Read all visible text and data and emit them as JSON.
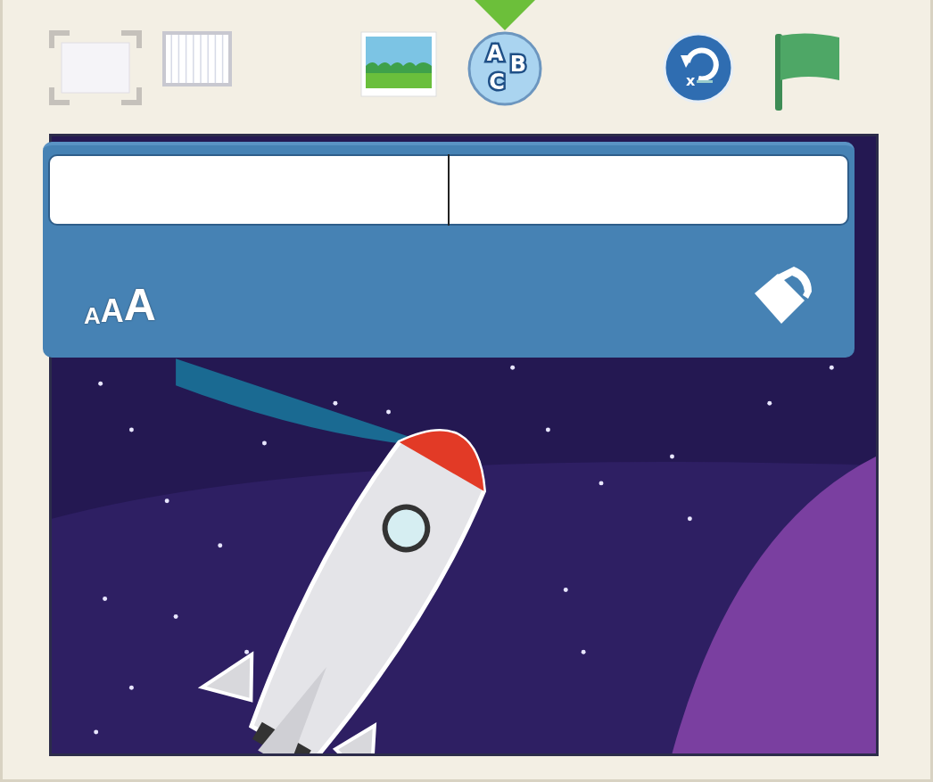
{
  "toolbar": {
    "tools": [
      {
        "kind": "fullscreen",
        "selected": false
      },
      {
        "kind": "grid",
        "selected": false
      },
      {
        "kind": "background",
        "selected": false
      },
      {
        "kind": "text",
        "selected": true,
        "letters": [
          "A",
          "B",
          "C"
        ]
      },
      {
        "kind": "reset",
        "selected": false,
        "letters": [
          "x"
        ]
      },
      {
        "kind": "flag",
        "selected": false
      }
    ]
  },
  "text_editor": {
    "focused": true,
    "size_letters": [
      "A",
      "A",
      "A"
    ]
  }
}
